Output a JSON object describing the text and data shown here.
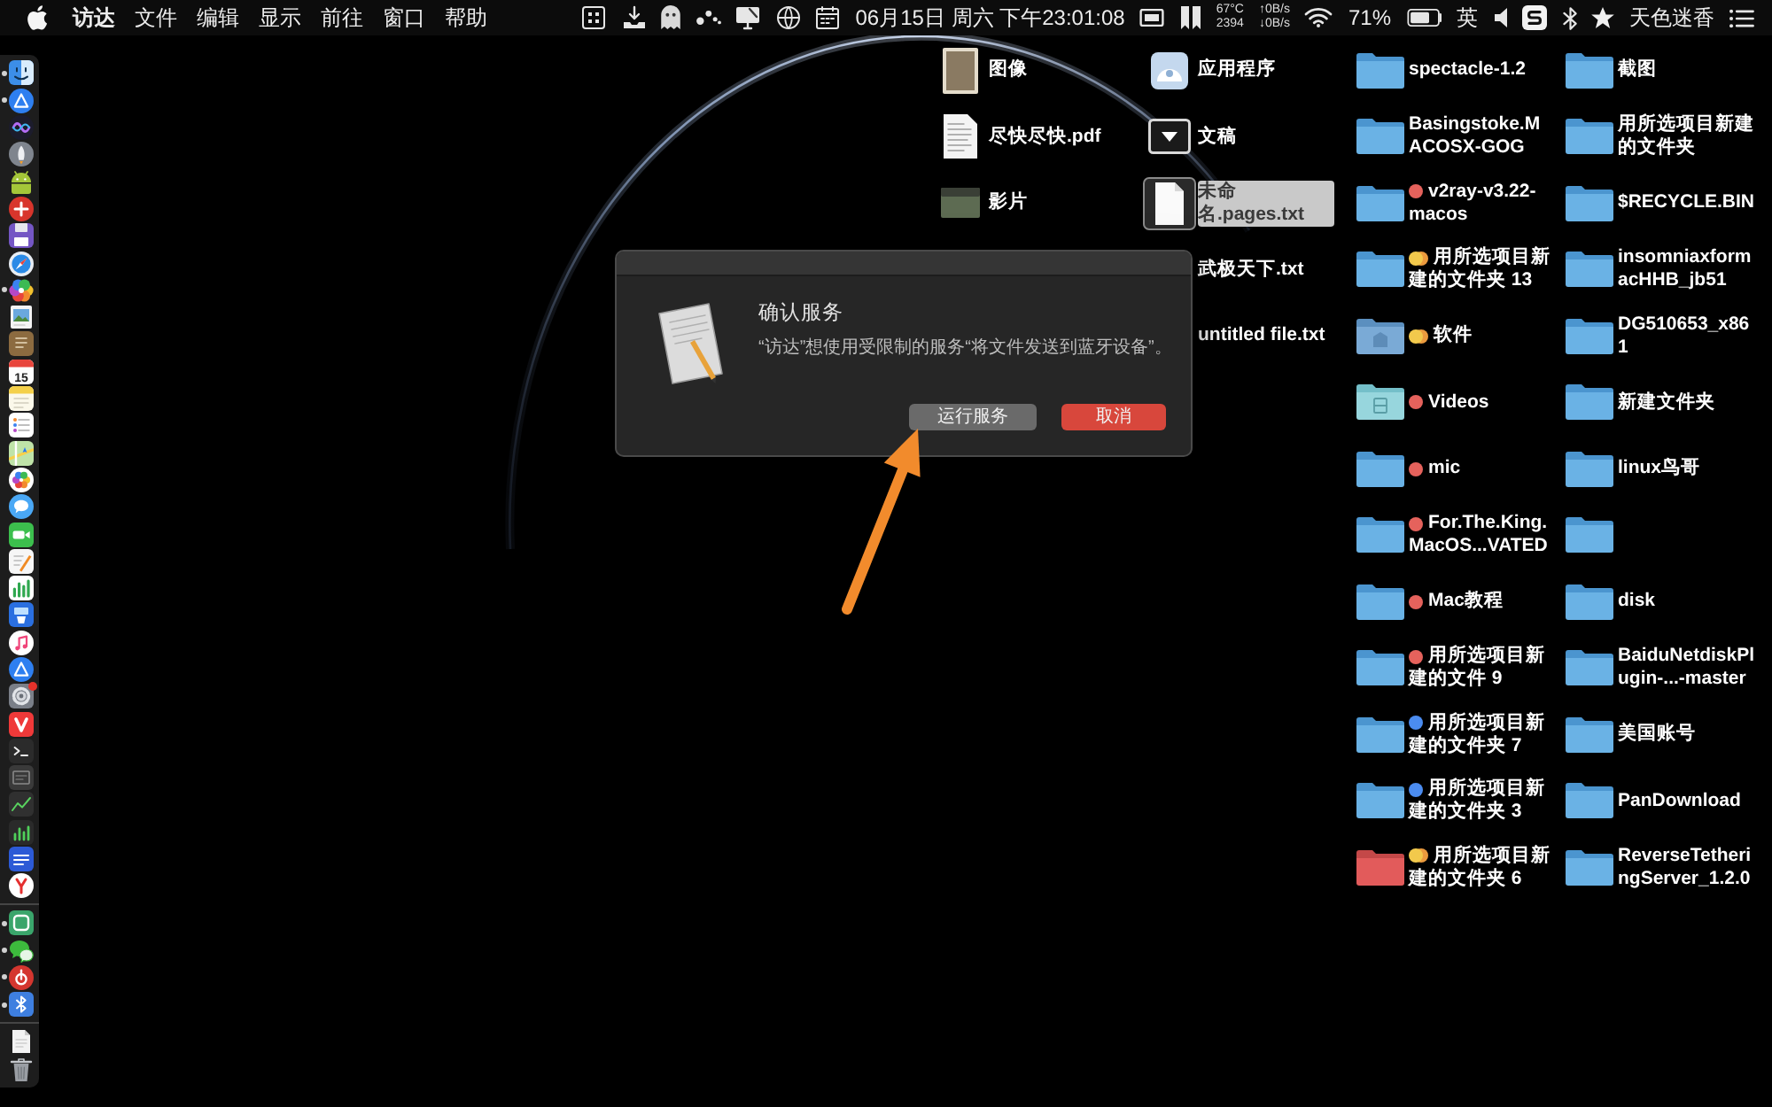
{
  "menu_bar": {
    "app_menu": "访达",
    "menus": [
      "文件",
      "编辑",
      "显示",
      "前往",
      "窗口",
      "帮助"
    ],
    "clock": "06月15日 周六 下午23:01:08",
    "sensor": [
      "67°C",
      "2394"
    ],
    "network": [
      "↑0B/s",
      "↓0B/s"
    ],
    "battery_percent": "71%",
    "input_source": "英",
    "user": "天色迷香"
  },
  "dock": {
    "sections": [
      {
        "items": [
          {
            "kind": "face",
            "running": true,
            "badge": false
          },
          {
            "kind": "triangle-disc",
            "running": true,
            "badge": false
          },
          {
            "kind": "wave-disc",
            "running": false,
            "badge": false
          },
          {
            "kind": "rocket",
            "running": false,
            "badge": false
          },
          {
            "kind": "robot",
            "running": false,
            "badge": false
          },
          {
            "kind": "cross-disc",
            "running": false,
            "badge": false
          },
          {
            "kind": "floppy",
            "running": false,
            "badge": false
          },
          {
            "kind": "compass",
            "running": false,
            "badge": false
          },
          {
            "kind": "color-wheel",
            "running": true,
            "badge": false
          },
          {
            "kind": "picture",
            "running": false,
            "badge": false
          },
          {
            "kind": "notebook",
            "running": false,
            "badge": false
          },
          {
            "kind": "calendar",
            "running": false,
            "badge": false,
            "label": "15"
          },
          {
            "kind": "notepad",
            "running": false,
            "badge": false
          },
          {
            "kind": "checklist",
            "running": false,
            "badge": false
          },
          {
            "kind": "map",
            "running": false,
            "badge": false
          },
          {
            "kind": "flower",
            "running": false,
            "badge": false
          },
          {
            "kind": "bubble",
            "running": false,
            "badge": false
          },
          {
            "kind": "camera",
            "running": false,
            "badge": false
          },
          {
            "kind": "pen-paper",
            "running": false,
            "badge": false
          },
          {
            "kind": "bars",
            "running": false,
            "badge": false
          },
          {
            "kind": "podium",
            "running": false,
            "badge": false
          },
          {
            "kind": "music",
            "running": false,
            "badge": false
          },
          {
            "kind": "triangle-disc",
            "running": false,
            "badge": false
          },
          {
            "kind": "gear",
            "running": false,
            "badge": true
          },
          {
            "kind": "chevron",
            "running": false,
            "badge": false
          },
          {
            "kind": "terminal",
            "running": false,
            "badge": false
          },
          {
            "kind": "window",
            "running": false,
            "badge": false
          },
          {
            "kind": "graph",
            "running": false,
            "badge": false
          },
          {
            "kind": "meter",
            "running": false,
            "badge": false
          },
          {
            "kind": "shield",
            "running": false,
            "badge": false
          },
          {
            "kind": "fork",
            "running": false,
            "badge": false
          }
        ]
      },
      {
        "items": [
          {
            "kind": "rounded-square",
            "running": true,
            "badge": false
          },
          {
            "kind": "chat",
            "running": true,
            "badge": false
          },
          {
            "kind": "spiral",
            "running": true,
            "badge": false
          },
          {
            "kind": "bluetooth",
            "running": true,
            "badge": false
          }
        ]
      },
      {
        "items": [
          {
            "kind": "document",
            "running": false,
            "badge": false
          },
          {
            "kind": "trash",
            "running": false,
            "badge": false
          }
        ]
      }
    ]
  },
  "desktop": {
    "columns": [
      {
        "items": [
          {
            "kind": "photo",
            "name": "图像",
            "selected": false
          },
          {
            "kind": "pdf",
            "name": "尽快尽快.pdf",
            "selected": false
          },
          {
            "kind": "video",
            "name": "影片",
            "selected": false
          }
        ]
      },
      {
        "items": [
          {
            "kind": "apps",
            "name": "应用程序",
            "selected": false
          },
          {
            "kind": "dropdown",
            "name": "文稿",
            "selected": false
          },
          {
            "kind": "text",
            "name": "未命名.pages.txt",
            "selected": true
          },
          {
            "name": "武极天下.txt",
            "selected": false
          },
          {
            "name": "untitled file.txt",
            "selected": false
          }
        ]
      },
      {
        "items": [
          {
            "kind": "folder",
            "name": "spectacle-1.2",
            "selected": false
          },
          {
            "kind": "folder",
            "name": "Basingstoke.MACOSX-GOG",
            "selected": false
          },
          {
            "kind": "folder",
            "name": "v2ray-v3.22-macos",
            "selected": false,
            "tags": [
              {
                "color": "#e5625c"
              }
            ]
          },
          {
            "kind": "folder",
            "name": "用所选项目新建的文件夹 13",
            "selected": false,
            "tags": [
              {
                "color": "#f2c94c"
              },
              {
                "color": "#eb9a3e"
              }
            ]
          },
          {
            "kind": "app-folder",
            "name": "软件",
            "selected": false,
            "tags": [
              {
                "color": "#f2c94c"
              },
              {
                "color": "#eb9a3e"
              }
            ]
          },
          {
            "kind": "media-folder",
            "name": "Videos",
            "selected": false,
            "tags": [
              {
                "color": "#e5625c"
              }
            ]
          },
          {
            "kind": "folder",
            "name": "mic",
            "selected": false,
            "tags": [
              {
                "color": "#e5625c"
              }
            ]
          },
          {
            "kind": "folder",
            "name": "For.The.King.MacOS...VATED",
            "selected": false,
            "tags": [
              {
                "color": "#e5625c"
              }
            ]
          },
          {
            "kind": "folder",
            "name": "Mac教程",
            "selected": false,
            "tags": [
              {
                "color": "#e5625c"
              }
            ]
          },
          {
            "kind": "folder",
            "name": "用所选项目新建的文件 9",
            "selected": false,
            "tags": [
              {
                "color": "#e5625c"
              }
            ]
          },
          {
            "kind": "folder",
            "name": "用所选项目新建的文件夹 7",
            "selected": false,
            "tags": [
              {
                "color": "#4b8cf0"
              }
            ]
          },
          {
            "kind": "folder",
            "name": "用所选项目新建的文件夹 3",
            "selected": false,
            "tags": [
              {
                "color": "#4b8cf0"
              }
            ]
          },
          {
            "kind": "red-folder",
            "name": "用所选项目新建的文件夹 6",
            "selected": false,
            "tags": [
              {
                "color": "#f2c94c"
              },
              {
                "color": "#eb9a3e"
              }
            ]
          }
        ]
      },
      {
        "items": [
          {
            "kind": "folder",
            "name": "截图",
            "selected": false
          },
          {
            "kind": "folder",
            "name": "用所选项目新建的文件夹",
            "selected": false
          },
          {
            "kind": "folder",
            "name": "$RECYCLE.BIN",
            "selected": false
          },
          {
            "kind": "folder",
            "name": "insomniaxformacHHB_jb51",
            "selected": false
          },
          {
            "kind": "folder",
            "name": "DG510653_x861",
            "selected": false
          },
          {
            "kind": "folder",
            "name": "新建文件夹",
            "selected": false
          },
          {
            "kind": "folder",
            "name": "linux鸟哥",
            "selected": false
          },
          {
            "kind": "folder",
            "selected": false
          },
          {
            "kind": "folder",
            "name": "disk",
            "selected": false
          },
          {
            "kind": "folder",
            "name": "BaiduNetdiskPlugin-...-master",
            "selected": false
          },
          {
            "kind": "folder",
            "name": "美国账号",
            "selected": false
          },
          {
            "kind": "folder",
            "name": "PanDownload",
            "selected": false
          },
          {
            "kind": "folder",
            "name": "ReverseTetheringServer_1.2.0",
            "selected": false
          }
        ]
      }
    ]
  },
  "dialog": {
    "title": "确认服务",
    "message": "“访达”想使用受限制的服务“将文件发送到蓝牙设备”。",
    "buttons": [
      {
        "label": "运行服务",
        "default": false
      },
      {
        "label": "取消",
        "default": true
      }
    ]
  }
}
